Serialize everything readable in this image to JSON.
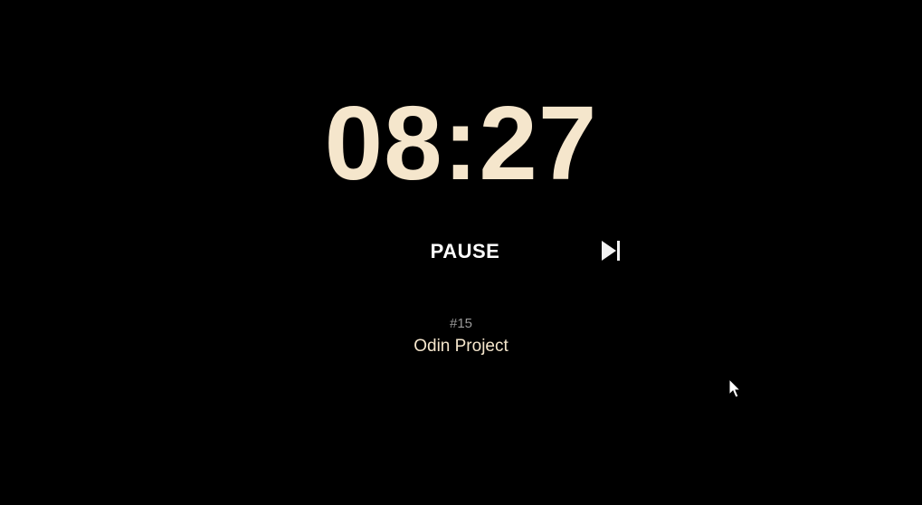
{
  "timer": {
    "time": "08:27"
  },
  "controls": {
    "pause_label": "PAUSE",
    "skip_icon": "skip-next-icon"
  },
  "session": {
    "number": "#15",
    "task": "Odin Project"
  },
  "colors": {
    "background": "#000000",
    "accent": "#f5e6cc",
    "button_text": "#ffffff",
    "muted": "#9a9a9a"
  }
}
